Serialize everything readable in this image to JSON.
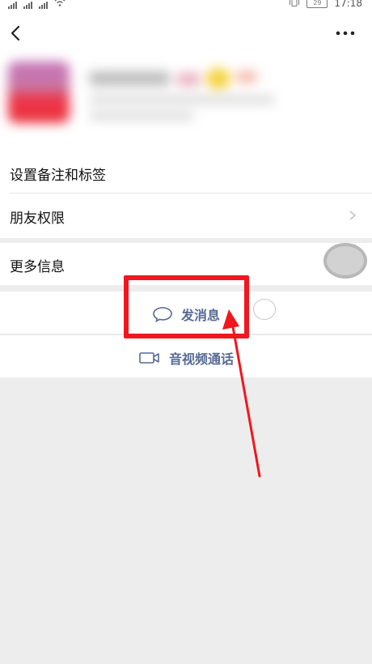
{
  "status_bar": {
    "time": "17:18",
    "battery": "29"
  },
  "header": {
    "back_icon": "chevron-left-icon",
    "more_icon": "more-dots-icon"
  },
  "profile": {
    "avatar_colors": [
      "#c46fb6",
      "#ef3346"
    ],
    "blurred": true
  },
  "menu": {
    "remark_tags": "设置备注和标签",
    "friend_permissions": "朋友权限",
    "more_info": "更多信息"
  },
  "actions": {
    "send_message": "发消息",
    "send_message_icon": "chat-bubble-icon",
    "video_call": "音视频通话",
    "video_call_icon": "video-camera-icon"
  },
  "colors": {
    "link": "#576b95",
    "annotation_red": "#f2161e",
    "background": "#ededed"
  },
  "annotation": {
    "type": "red-box-with-arrow",
    "target": "send-message-button"
  }
}
